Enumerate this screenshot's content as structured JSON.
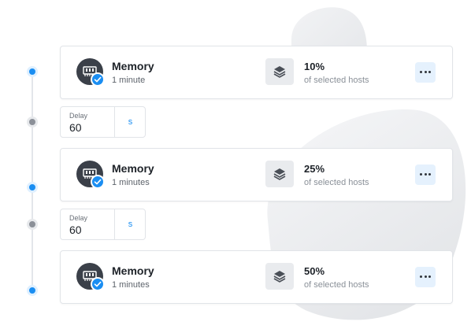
{
  "steps": [
    {
      "title": "Memory",
      "duration": "1 minute",
      "percent": "10%",
      "percent_label": "of selected hosts"
    },
    {
      "title": "Memory",
      "duration": "1 minutes",
      "percent": "25%",
      "percent_label": "of selected hosts"
    },
    {
      "title": "Memory",
      "duration": "1 minutes",
      "percent": "50%",
      "percent_label": "of selected hosts"
    }
  ],
  "delays": [
    {
      "label": "Delay",
      "value": "60",
      "unit": "s"
    },
    {
      "label": "Delay",
      "value": "60",
      "unit": "s"
    }
  ],
  "colors": {
    "accent": "#1b8ef2",
    "inactive_dot": "#8b9098",
    "avatar": "#3b4049",
    "more_button_bg": "#e5f1fd"
  },
  "icons": [
    "memory-chip-icon",
    "check-icon",
    "layers-icon",
    "more-icon"
  ]
}
